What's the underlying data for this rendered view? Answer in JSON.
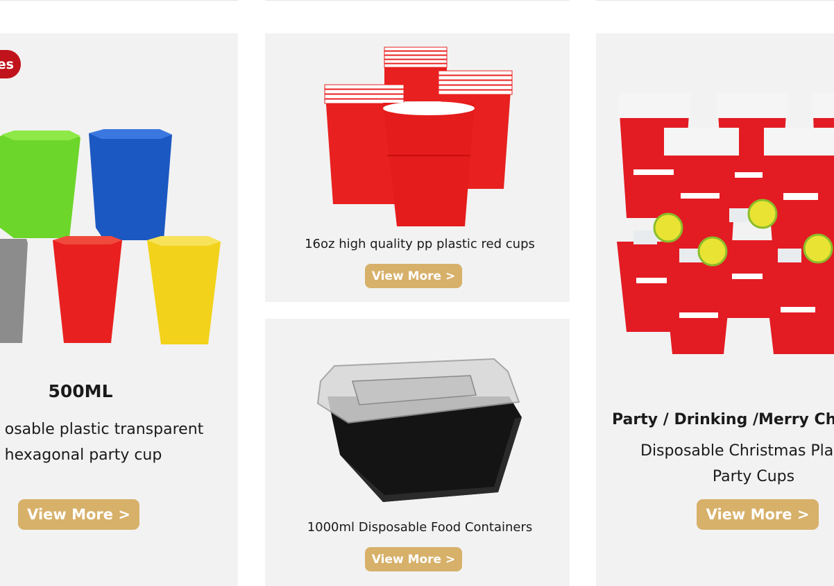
{
  "cards": {
    "left": {
      "badge": "es",
      "title": "500ML",
      "desc_line1": "osable plastic transparent",
      "desc_line2": "hexagonal party cup",
      "button": "View More >"
    },
    "middle_top": {
      "title": "16oz high quality pp plastic red cups",
      "button": "View More >"
    },
    "middle_bottom": {
      "title": "1000ml  Disposable Food Containers",
      "button": "View More >"
    },
    "right": {
      "title": "Party / Drinking /Merry Chr",
      "desc_line1": "Disposable Christmas Pla",
      "desc_line2": "Party Cups",
      "button": "View More >"
    }
  },
  "colors": {
    "card_bg": "#f2f2f2",
    "button": "#d7b06a",
    "badge": "#c0131b",
    "cup_red": "#e8201f"
  }
}
